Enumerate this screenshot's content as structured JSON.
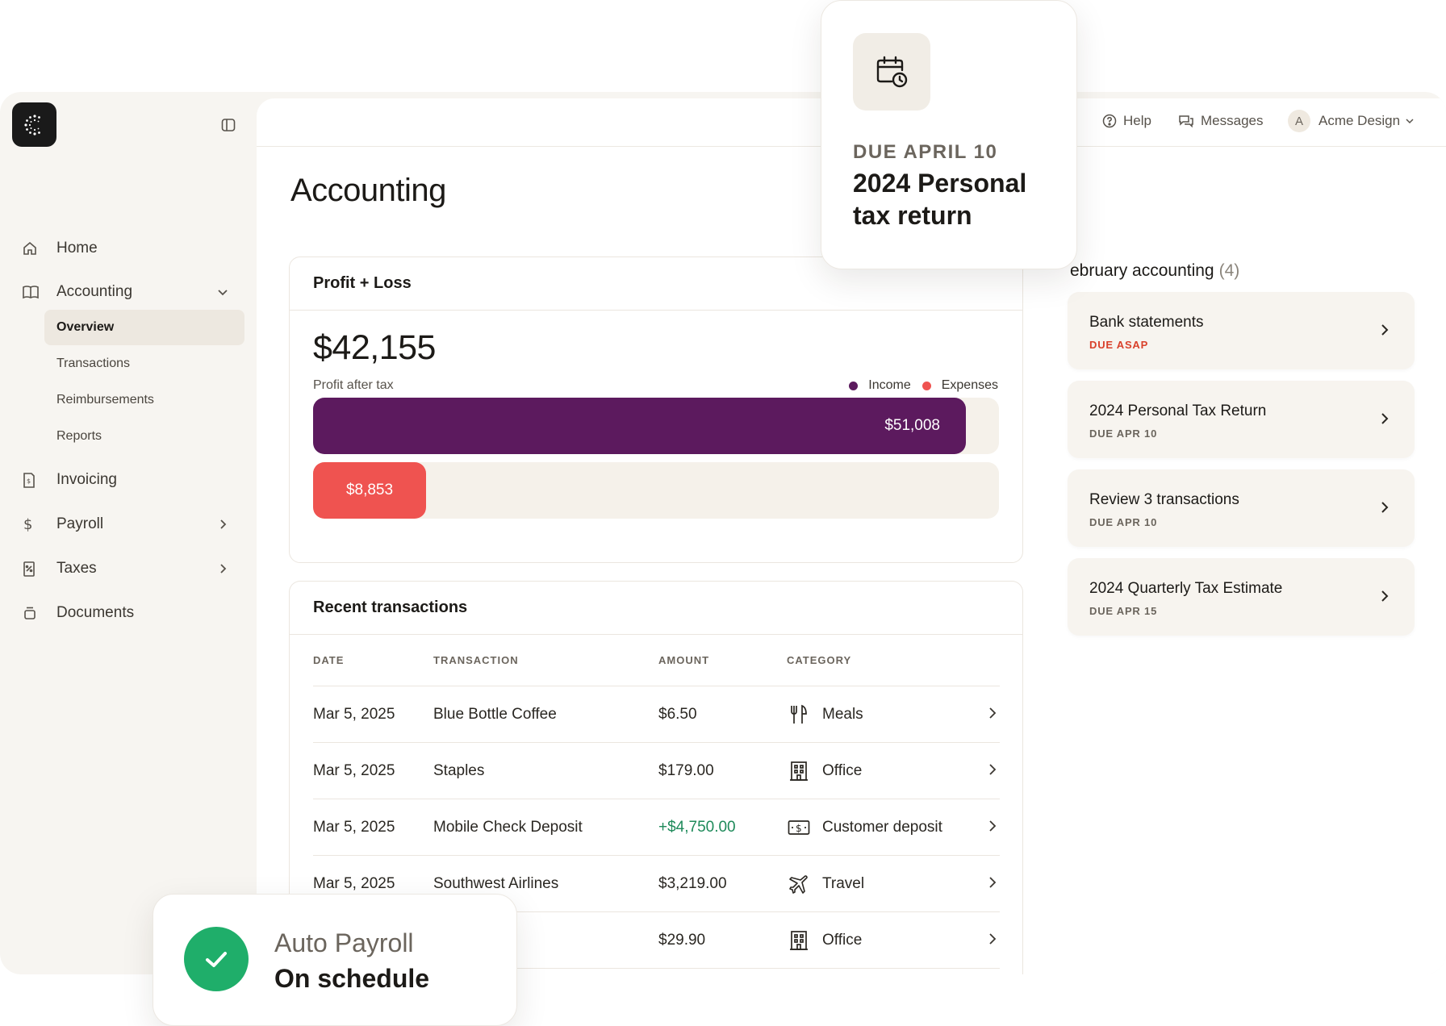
{
  "sidebar": {
    "items": [
      {
        "label": "Home",
        "icon": "home-icon"
      },
      {
        "label": "Accounting",
        "icon": "book-icon"
      },
      {
        "label": "Invoicing",
        "icon": "invoice-icon"
      },
      {
        "label": "Payroll",
        "icon": "dollar-icon"
      },
      {
        "label": "Taxes",
        "icon": "tax-receipt-icon"
      },
      {
        "label": "Documents",
        "icon": "archive-icon"
      }
    ],
    "accounting_sub": [
      "Overview",
      "Transactions",
      "Reimbursements",
      "Reports"
    ]
  },
  "topbar": {
    "help": "Help",
    "messages": "Messages",
    "avatar_letter": "A",
    "org": "Acme Design"
  },
  "page": {
    "title": "Accounting"
  },
  "profit_loss": {
    "title": "Profit + Loss",
    "amount": "$42,155",
    "subtitle": "Profit after tax",
    "legend_income": "Income",
    "legend_expenses": "Expenses",
    "income_label": "$51,008",
    "expenses_label": "$8,853",
    "income_value": 51008,
    "expenses_value": 8853,
    "scale_max": 53600,
    "colors": {
      "income": "#5c1a5e",
      "expenses": "#ef5350"
    }
  },
  "transactions": {
    "title": "Recent transactions",
    "headers": [
      "DATE",
      "TRANSACTION",
      "AMOUNT",
      "CATEGORY"
    ],
    "rows": [
      {
        "date": "Mar 5, 2025",
        "name": "Blue Bottle Coffee",
        "amount": "$6.50",
        "category": "Meals",
        "icon": "utensils-icon"
      },
      {
        "date": "Mar 5, 2025",
        "name": "Staples",
        "amount": "$179.00",
        "category": "Office",
        "icon": "building-icon"
      },
      {
        "date": "Mar 5, 2025",
        "name": "Mobile Check Deposit",
        "amount": "+$4,750.00",
        "category": "Customer deposit",
        "icon": "cash-icon"
      },
      {
        "date": "Mar 5, 2025",
        "name": "Southwest Airlines",
        "amount": "$3,219.00",
        "category": "Travel",
        "icon": "plane-icon"
      },
      {
        "date": "",
        "name": "",
        "amount": "$29.90",
        "category": "Office",
        "icon": "building-icon"
      }
    ],
    "positive_color": "#1e8a5a"
  },
  "tasks": {
    "title": "ebruary accounting",
    "count": "(4)",
    "items": [
      {
        "name": "Bank statements",
        "due": "DUE ASAP"
      },
      {
        "name": "2024 Personal Tax Return",
        "due": "DUE APR 10"
      },
      {
        "name": "Review 3 transactions",
        "due": "DUE APR 10"
      },
      {
        "name": "2024 Quarterly Tax Estimate",
        "due": "DUE APR 15"
      }
    ]
  },
  "float_due": {
    "label": "DUE APRIL 10",
    "title": "2024 Personal tax return"
  },
  "float_payroll": {
    "line1": "Auto Payroll",
    "line2": "On schedule"
  }
}
